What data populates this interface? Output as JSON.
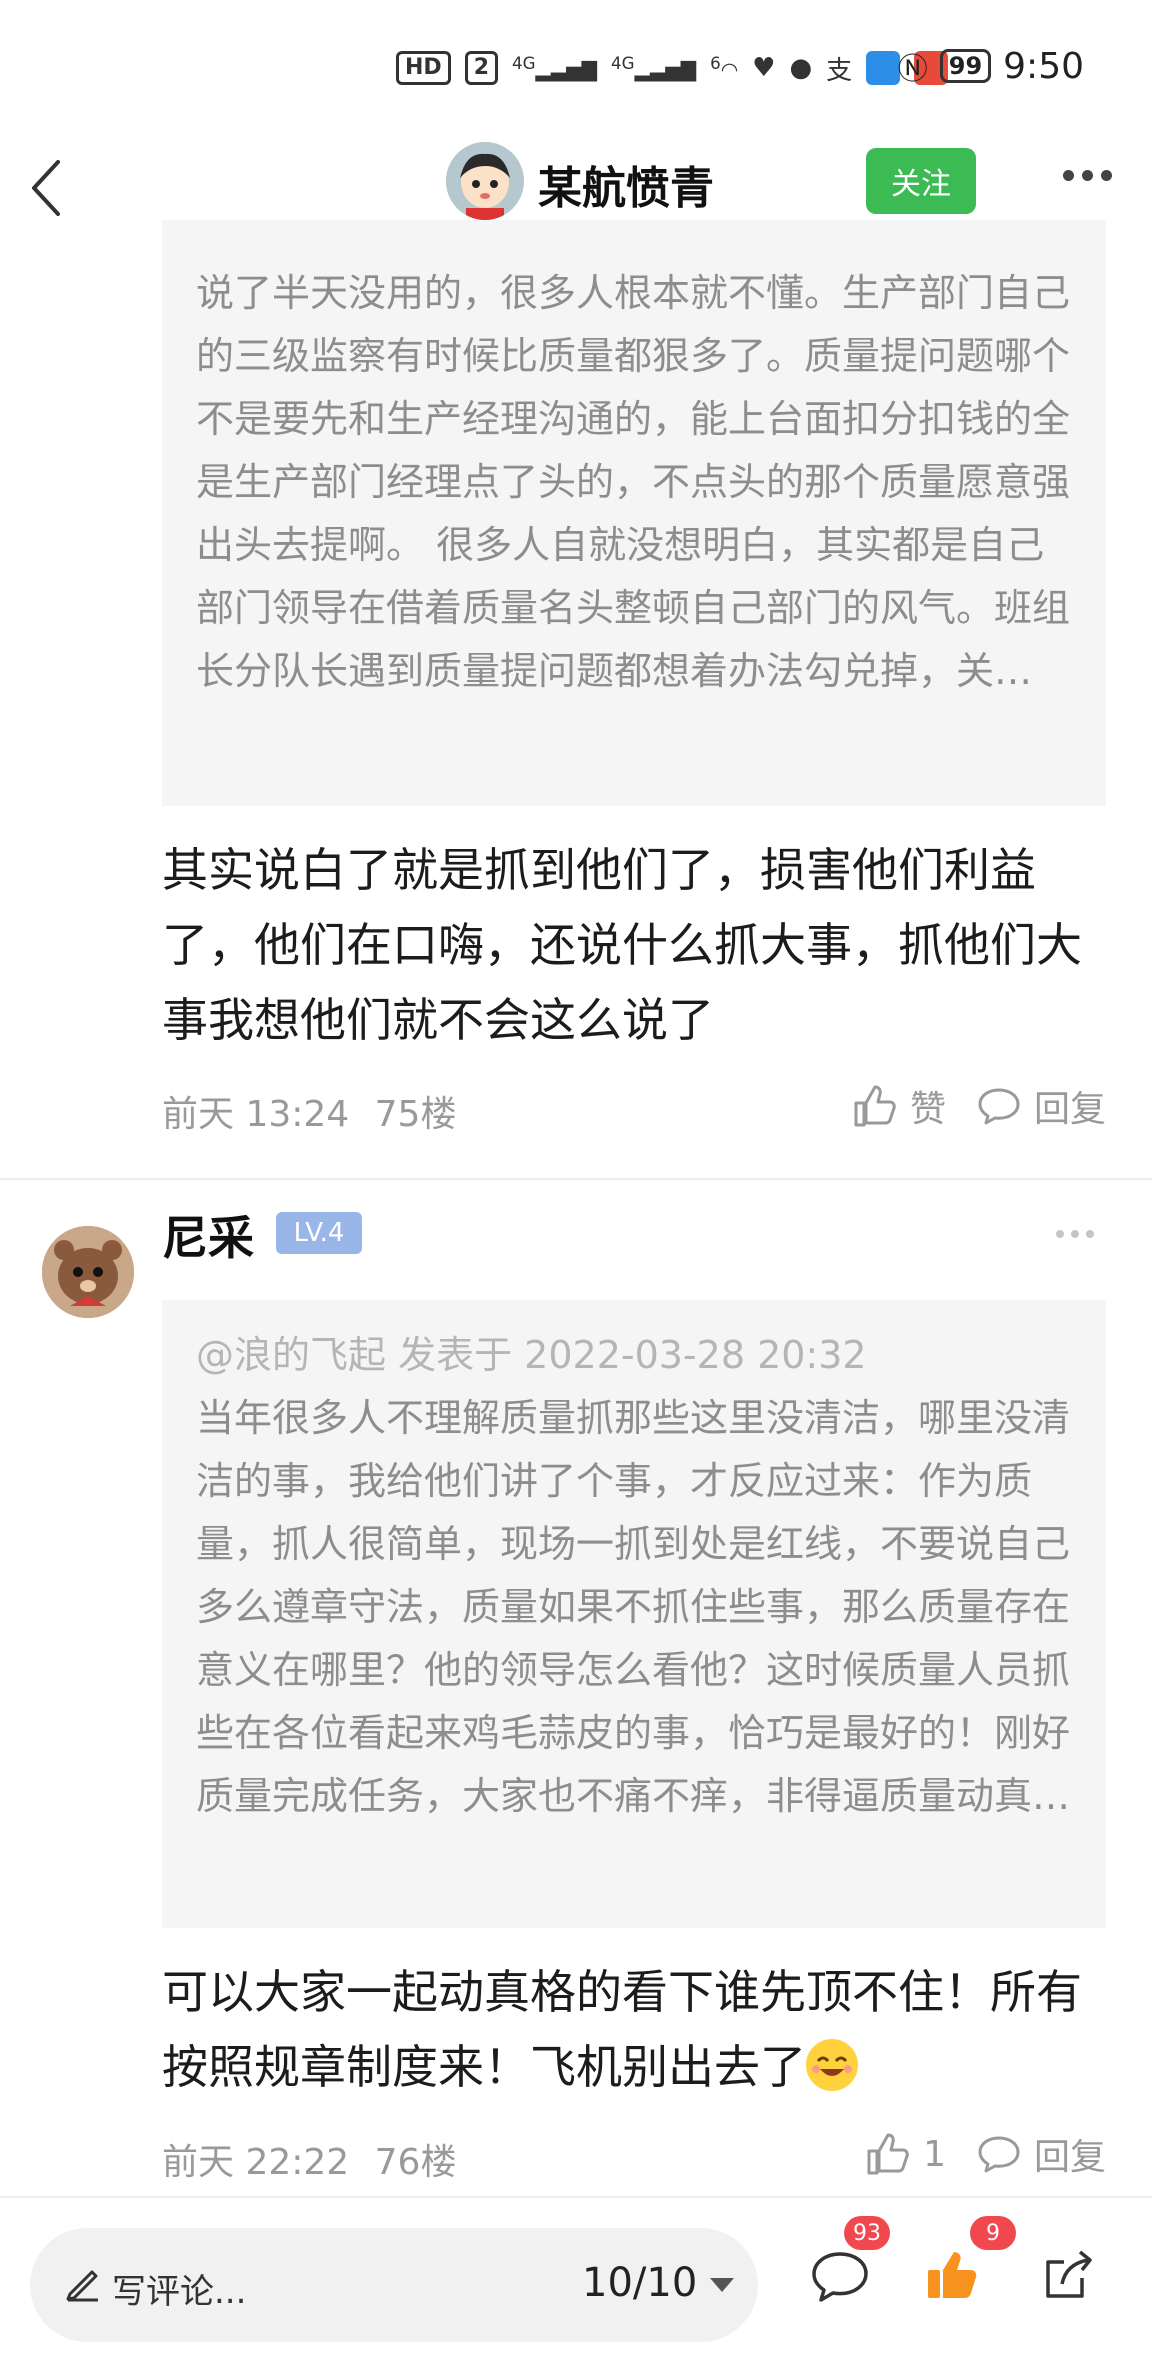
{
  "status_bar": {
    "time": "9:50",
    "battery": "99",
    "hd": "HD",
    "sim": "2",
    "net1": "4G",
    "net2": "4G",
    "wifi": "6"
  },
  "header": {
    "title": "某航愤青",
    "follow_label": "关注"
  },
  "comments": [
    {
      "quote_text": "说了半天没用的，很多人根本就不懂。生产部门自己的三级监察有时候比质量都狠多了。质量提问题哪个不是要先和生产经理沟通的，能上台面扣分扣钱的全是生产部门经理点了头的，不点头的那个质量愿意强出头去提啊。 很多人自就没想明白，其实都是自己部门领导在借着质量名头整顿自己部门的风气。班组长分队长遇到质量提问题都想着办法勾兑掉，关…",
      "text": "其实说白了就是抓到他们了，损害他们利益了，他们在口嗨，还说什么抓大事，抓他们大事我想他们就不会这么说了",
      "time": "前天 13:24",
      "floor": "75楼",
      "like_label": "赞",
      "reply_label": "回复"
    },
    {
      "username": "尼采",
      "level": "LV.4",
      "quote_meta": "@浪的飞起 发表于 2022-03-28 20:32",
      "quote_text": "当年很多人不理解质量抓那些这里没清洁，哪里没清洁的事，我给他们讲了个事，才反应过来：作为质量，抓人很简单，现场一抓到处是红线，不要说自己多么遵章守法，质量如果不抓住些事，那么质量存在意义在哪里？他的领导怎么看他？这时候质量人员抓些在各位看起来鸡毛蒜皮的事，恰巧是最好的！刚好质量完成任务，大家也不痛不痒，非得逼质量动真…",
      "text": "可以大家一起动真格的看下谁先顶不住！所有按照规章制度来！飞机别出去了",
      "time": "前天 22:22",
      "floor": "76楼",
      "like_count": "1",
      "reply_label": "回复"
    }
  ],
  "bottom_bar": {
    "comment_placeholder": "写评论...",
    "pager": "10/10",
    "comments_badge": "93",
    "likes_badge": "9"
  },
  "colors": {
    "follow_green": "#3cba54",
    "level_blue": "#98b6e8",
    "badge_red": "#f1474f",
    "like_orange": "#f7921e"
  }
}
